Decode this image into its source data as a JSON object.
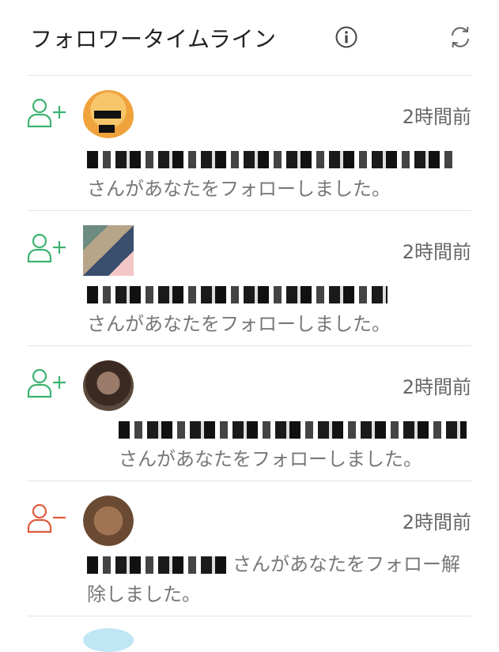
{
  "header": {
    "title": "フォロワータイムライン",
    "info_icon": "info-icon",
    "refresh_icon": "refresh-icon"
  },
  "colors": {
    "follow": "#3cb371",
    "unfollow": "#e05a3c",
    "divider": "#e3e3e3"
  },
  "timeline": [
    {
      "action": "follow",
      "icon": "user-plus-icon",
      "time": "2時間前",
      "message": "さんがあなたをフォローしました。"
    },
    {
      "action": "follow",
      "icon": "user-plus-icon",
      "time": "2時間前",
      "message": "さんがあなたをフォローしました。"
    },
    {
      "action": "follow",
      "icon": "user-plus-icon",
      "time": "2時間前",
      "message": "さんがあなたをフォローしました。"
    },
    {
      "action": "unfollow",
      "icon": "user-minus-icon",
      "time": "2時間前",
      "message": "さんがあなたをフォロー解除しました。"
    }
  ]
}
